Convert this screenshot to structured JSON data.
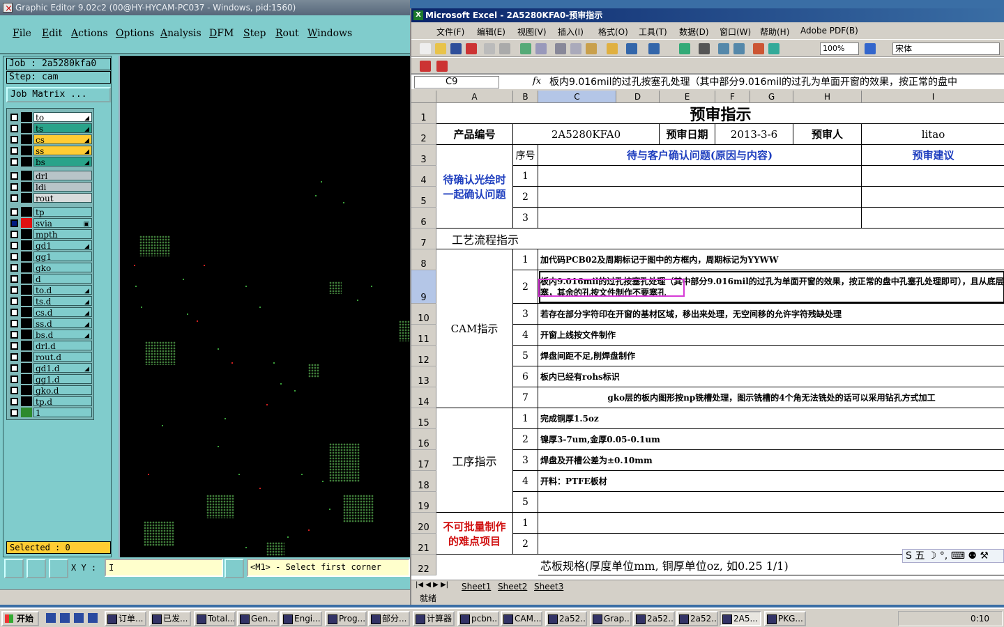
{
  "graphic_editor": {
    "title": "Graphic Editor 9.02c2 (00@HY-HYCAM-PC037 - Windows, pid:1560)",
    "menu": [
      "File",
      "Edit",
      "Actions",
      "Options",
      "Analysis",
      "DFM",
      "Step",
      "Rout",
      "Windows"
    ],
    "job": "Job : 2a5280kfa0",
    "step": "Step: cam",
    "job_matrix": "Job Matrix ...",
    "layers": [
      {
        "name": "to",
        "color": "#ffffff",
        "marker": "◢"
      },
      {
        "name": "ts",
        "color": "#29a38a",
        "marker": "◢"
      },
      {
        "name": "cs",
        "color": "#ffcc33",
        "marker": "◢"
      },
      {
        "name": "ss",
        "color": "#ffcc33",
        "marker": "◢"
      },
      {
        "name": "bs",
        "color": "#29a38a",
        "marker": "◢"
      },
      {
        "name": "drl",
        "color": "#b8c4c8",
        "marker": ""
      },
      {
        "name": "ldi",
        "color": "#b8c4c8",
        "marker": ""
      },
      {
        "name": "rout",
        "color": "#d8dcdc",
        "marker": ""
      },
      {
        "name": "tp",
        "color": "#80cccc",
        "marker": ""
      },
      {
        "name": "svia",
        "color": "#80cccc",
        "marker": "▣"
      },
      {
        "name": "mpth",
        "color": "#80cccc",
        "marker": ""
      },
      {
        "name": "gd1",
        "color": "#80cccc",
        "marker": "◢"
      },
      {
        "name": "gg1",
        "color": "#80cccc",
        "marker": ""
      },
      {
        "name": "gko",
        "color": "#80cccc",
        "marker": ""
      },
      {
        "name": "d",
        "color": "#80cccc",
        "marker": ""
      },
      {
        "name": "to.d",
        "color": "#80cccc",
        "marker": "◢"
      },
      {
        "name": "ts.d",
        "color": "#80cccc",
        "marker": "◢"
      },
      {
        "name": "cs.d",
        "color": "#80cccc",
        "marker": "◢"
      },
      {
        "name": "ss.d",
        "color": "#80cccc",
        "marker": "◢"
      },
      {
        "name": "bs.d",
        "color": "#80cccc",
        "marker": "◢"
      },
      {
        "name": "drl.d",
        "color": "#80cccc",
        "marker": ""
      },
      {
        "name": "rout.d",
        "color": "#80cccc",
        "marker": ""
      },
      {
        "name": "gd1.d",
        "color": "#80cccc",
        "marker": "◢"
      },
      {
        "name": "gg1.d",
        "color": "#80cccc",
        "marker": ""
      },
      {
        "name": "gko.d",
        "color": "#80cccc",
        "marker": ""
      },
      {
        "name": "tp.d",
        "color": "#80cccc",
        "marker": ""
      },
      {
        "name": "1",
        "color": "#80cccc",
        "marker": ""
      }
    ],
    "selected": "Selected : 0",
    "xy_label": "X Y :",
    "xy_value": "I",
    "status": "<M1> - Select first corner"
  },
  "excel": {
    "title": "Microsoft Excel - 2A5280KFA0-预审指示",
    "menu": [
      "文件(F)",
      "编辑(E)",
      "视图(V)",
      "插入(I)",
      "格式(O)",
      "工具(T)",
      "数据(D)",
      "窗口(W)",
      "帮助(H)",
      "Adobe PDF(B)"
    ],
    "zoom": "100%",
    "font": "宋体",
    "name_box": "C9",
    "fx": "fx",
    "formula": "板内9.016mil的过孔按塞孔处理（其中部分9.016mil的过孔为单面开窗的效果，按正常的盘中",
    "columns": [
      "A",
      "B",
      "C",
      "D",
      "E",
      "F",
      "G",
      "H",
      "I"
    ],
    "rows": [
      "1",
      "2",
      "3",
      "4",
      "5",
      "6",
      "7",
      "8",
      "9",
      "10",
      "11",
      "12",
      "13",
      "14",
      "15",
      "16",
      "17",
      "18",
      "19",
      "20",
      "21",
      "22"
    ],
    "sheet": {
      "title": "预审指示",
      "product_no_label": "产品编号",
      "product_no": "2A5280KFA0",
      "review_date_label": "预审日期",
      "review_date": "2013-3-6",
      "reviewer_label": "预审人",
      "reviewer": "litao",
      "confirm_label": "待确认光绘时一起确认问题",
      "seq_label": "序号",
      "confirm_header": "待与客户确认问题(原因与内容)",
      "advice_header": "预审建议",
      "confirm_nums": [
        "1",
        "2",
        "3"
      ],
      "process_label": "工艺流程指示",
      "cam_label": "CAM指示",
      "cam_items": [
        {
          "n": "1",
          "text": "加代码PCB02及周期标记于图中的方框内，周期标记为YYWW"
        },
        {
          "n": "2",
          "text": "板内9.016mil的过孔按塞孔处理（其中部分9.016mil的过孔为单面开窗的效果，按正常的盘中孔塞孔处理即可），且从底层塞，其余的孔按文件制作不要塞孔"
        },
        {
          "n": "3",
          "text": "若存在部分字符印在开窗的基材区域，移出来处理，无空间移的允许字符残缺处理"
        },
        {
          "n": "4",
          "text": "开窗上线按文件制作"
        },
        {
          "n": "5",
          "text": "焊盘间距不足,削焊盘制作"
        },
        {
          "n": "6",
          "text": "板内已经有rohs标识"
        },
        {
          "n": "7",
          "text": "gko层的板内图形按np铣槽处理，图示铣槽的4个角无法铣处的话可以采用钻孔方式加工"
        }
      ],
      "op_label": "工序指示",
      "op_items": [
        {
          "n": "1",
          "text": "完成铜厚1.5oz"
        },
        {
          "n": "2",
          "text": "镍厚3-7um,金厚0.05-0.1um"
        },
        {
          "n": "3",
          "text": "焊盘及开槽公差为±0.10mm"
        },
        {
          "n": "4",
          "text": "开料：PTFE板材"
        },
        {
          "n": "5",
          "text": ""
        }
      ],
      "hard_label": "不可批量制作的难点项目",
      "hard_nums": [
        "1",
        "2"
      ],
      "core_label": "芯板规格(厚度单位mm, 铜厚单位oz, 如0.25 1/1)"
    },
    "sheet_tabs": [
      "Sheet1",
      "Sheet2",
      "Sheet3"
    ],
    "status": "就绪",
    "ime": "S 五 ☽ °, ⌨ ⚉ ⚒"
  },
  "taskbar": {
    "start": "开始",
    "tasks": [
      "订单...",
      "已发...",
      "Total...",
      "Gen...",
      "Engi...",
      "Prog...",
      "部分...",
      "计算器",
      "pcbn...",
      "CAM...",
      "2a52...",
      "Grap...",
      "2a52...",
      "2a52...",
      "2A5...",
      "PKG..."
    ],
    "clock": "0:10"
  }
}
